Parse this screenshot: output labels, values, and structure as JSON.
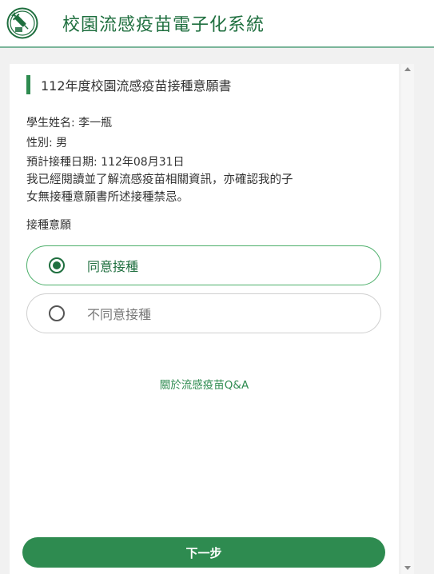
{
  "header": {
    "app_title": "校園流感疫苗電子化系統",
    "logo_icon": "vaccine-syringe-logo"
  },
  "form": {
    "section_title": "112年度校園流感疫苗接種意願書",
    "student_name_line": "學生姓名: 李一瓶",
    "gender_line": "性別: 男",
    "scheduled_date_line": "預計接種日期: 112年08月31日",
    "declaration_line1": "我已經閱讀並了解流感疫苗相關資訊，亦確認我的子",
    "declaration_line2": "女無接種意願書所述接種禁忌。",
    "consent_label": "接種意願",
    "options": [
      {
        "label": "同意接種",
        "selected": true
      },
      {
        "label": "不同意接種",
        "selected": false
      }
    ],
    "qa_link": "關於流感疫苗Q&A",
    "next_button": "下一步"
  },
  "colors": {
    "primary_green": "#2e8b50",
    "title_green": "#1f6f3f",
    "background": "#f1f1f1"
  }
}
